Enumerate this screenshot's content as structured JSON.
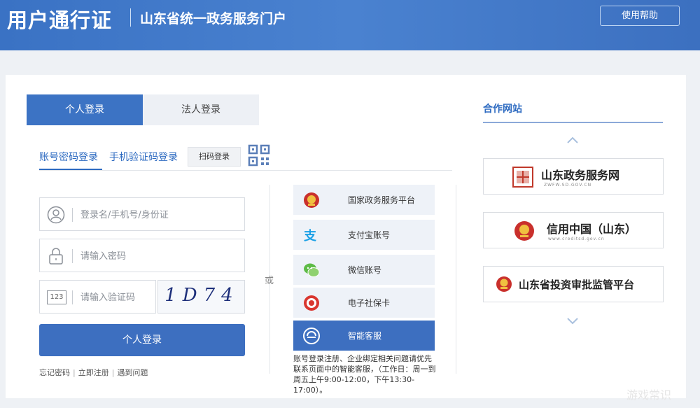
{
  "header": {
    "brand": "用户通行证",
    "subtitle": "山东省统一政务服务门户",
    "help_label": "使用帮助"
  },
  "tabs": {
    "personal": "个人登录",
    "legal": "法人登录"
  },
  "sub_tabs": {
    "account": "账号密码登录",
    "sms": "手机验证码登录",
    "scan": "扫码登录"
  },
  "form": {
    "username_placeholder": "登录名/手机号/身份证",
    "password_placeholder": "请输入密码",
    "captcha_placeholder": "请输入验证码",
    "captcha_code": "1D74",
    "captcha_icon_text": "123",
    "login_label": "个人登录"
  },
  "links": {
    "forgot": "忘记密码",
    "register": "立即注册",
    "problem": "遇到问题",
    "sep": "|"
  },
  "or_label": "或",
  "third_party": [
    {
      "label": "国家政务服务平台",
      "icon": "national-emblem-icon"
    },
    {
      "label": "支付宝账号",
      "icon": "alipay-icon"
    },
    {
      "label": "微信账号",
      "icon": "wechat-icon"
    },
    {
      "label": "电子社保卡",
      "icon": "social-security-card-icon"
    },
    {
      "label": "智能客服",
      "icon": "customer-service-icon"
    }
  ],
  "note": "账号登录注册、企业绑定相关问题请优先联系页面中的智能客服，（工作日：周一到周五上午9:00-12:00，下午13:30-17:00）。",
  "partners": {
    "title": "合作网站",
    "items": [
      {
        "name": "山东政务服务网",
        "sub": "ZWFW.SD.GOV.CN"
      },
      {
        "name": "信用中国（山东）",
        "sub": "www.creditsd.gov.cn"
      },
      {
        "name": "山东省投资审批监管平台",
        "sub": ""
      }
    ]
  },
  "watermark": "游戏常识",
  "colors": {
    "primary": "#3c73c4",
    "header": "#4a82d0",
    "link": "#2e6bc1"
  }
}
